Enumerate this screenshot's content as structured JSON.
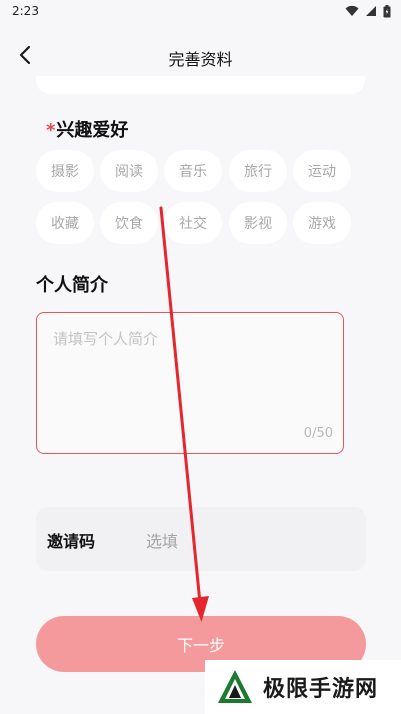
{
  "status_bar": {
    "time": "2:23"
  },
  "header": {
    "title": "完善资料"
  },
  "hobbies": {
    "required_mark": "*",
    "title": "兴趣爱好",
    "items": [
      "摄影",
      "阅读",
      "音乐",
      "旅行",
      "运动",
      "收藏",
      "饮食",
      "社交",
      "影视",
      "游戏"
    ]
  },
  "intro": {
    "title": "个人简介",
    "placeholder": "请填写个人简介",
    "counter": "0/50"
  },
  "invite": {
    "label": "邀请码",
    "placeholder": "选填"
  },
  "next_button": {
    "label": "下一步"
  },
  "watermark": {
    "text": "极限手游网"
  },
  "colors": {
    "accent": "#e8545a",
    "button_bg": "#f4999c",
    "annotation_arrow": "#e5262e"
  }
}
